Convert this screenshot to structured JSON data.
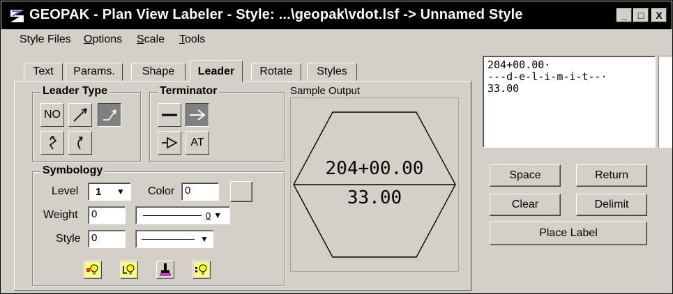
{
  "window": {
    "title": "GEOPAK - Plan View Labeler - Style: ...\\geopak\\vdot.lsf -> Unnamed Style",
    "buttons": {
      "minimize": "_",
      "maximize": "□",
      "close": "X"
    }
  },
  "menu": {
    "items": [
      "Style Files",
      "Options",
      "Scale",
      "Tools"
    ],
    "mnemonics": [
      "",
      "O",
      "S",
      "T"
    ]
  },
  "tabs": [
    {
      "label": "Text",
      "active": false
    },
    {
      "label": "Params.",
      "active": false
    },
    {
      "label": "Shape",
      "active": false
    },
    {
      "label": "Leader",
      "active": true
    },
    {
      "label": "Rotate",
      "active": false
    },
    {
      "label": "Styles",
      "active": false
    }
  ],
  "leader_type": {
    "title": "Leader Type",
    "no_label": "NO",
    "selected": "bent-arrow"
  },
  "terminator": {
    "title": "Terminator",
    "at_label": "AT",
    "selected": "arrow"
  },
  "symbology": {
    "title": "Symbology",
    "level_label": "Level",
    "level_value": "1",
    "color_label": "Color",
    "color_value": "0",
    "weight_label": "Weight",
    "weight_value": "0",
    "weight_combo_value": "0",
    "style_label": "Style",
    "style_value": "0"
  },
  "sample": {
    "title": "Sample Output",
    "line1": "204+00.00",
    "line2": "33.00"
  },
  "text_area": {
    "lines": [
      "204+00.00·",
      "---d-e-l-i-m-i-t--·",
      "33.00"
    ]
  },
  "buttons": {
    "space": "Space",
    "return": "Return",
    "clear": "Clear",
    "delimit": "Delimit",
    "place_label": "Place Label"
  },
  "colors": {
    "face": "#d4d0c8",
    "title_bg": "#000000",
    "shadow": "#808080",
    "hilite": "#ffffff"
  }
}
